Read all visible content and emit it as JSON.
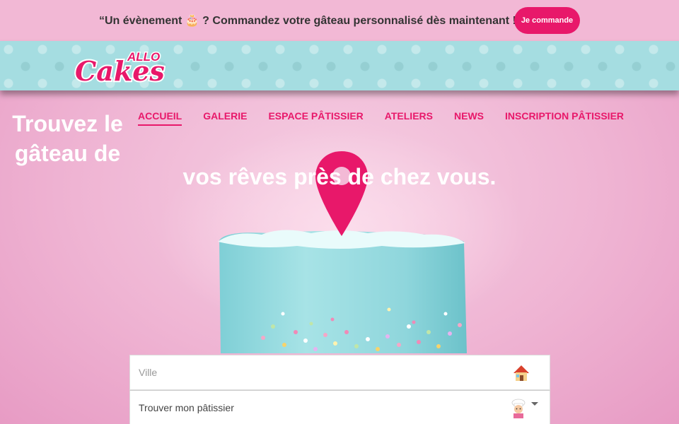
{
  "topbar": {
    "announcement": "“Un évènement 🎂 ? Commandez votre gâteau personnalisé dès maintenant !”",
    "order_button": "Je commande"
  },
  "brand": {
    "logo_top": "ALLO",
    "logo_main": "Cakes"
  },
  "nav": {
    "items": [
      {
        "label": "ACCUEIL"
      },
      {
        "label": "GALERIE"
      },
      {
        "label": "ESPACE PÂTISSIER"
      },
      {
        "label": "ATELIERS"
      },
      {
        "label": "NEWS"
      },
      {
        "label": "INSCRIPTION PÂTISSIER"
      }
    ]
  },
  "hero": {
    "left_title": "Trouvez le gâteau de",
    "center_title": "vos rêves près de chez vous."
  },
  "search": {
    "city_placeholder": "Ville",
    "patissier_select": "Trouver mon pâtissier"
  },
  "colors": {
    "accent": "#e8186a",
    "header_bg": "#a5dde1",
    "page_bg": "#efb4d3"
  }
}
